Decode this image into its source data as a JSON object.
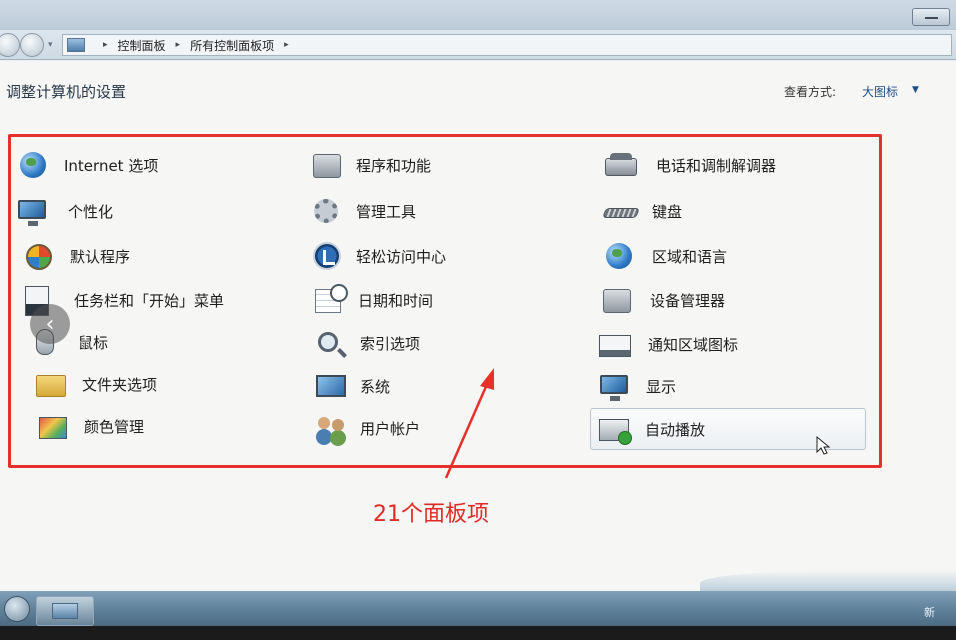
{
  "breadcrumb": {
    "items": [
      "控制面板",
      "所有控制面板项"
    ]
  },
  "header": {
    "title": "调整计算机的设置",
    "view_label": "查看方式:",
    "view_value": "大图标"
  },
  "items": [
    {
      "label": "Internet 选项",
      "icon": "internet-options-icon"
    },
    {
      "label": "程序和功能",
      "icon": "programs-features-icon"
    },
    {
      "label": "电话和调制解调器",
      "icon": "phone-modem-icon"
    },
    {
      "label": "个性化",
      "icon": "personalization-icon"
    },
    {
      "label": "管理工具",
      "icon": "admin-tools-icon"
    },
    {
      "label": "键盘",
      "icon": "keyboard-icon"
    },
    {
      "label": "默认程序",
      "icon": "default-programs-icon"
    },
    {
      "label": "轻松访问中心",
      "icon": "ease-of-access-icon"
    },
    {
      "label": "区域和语言",
      "icon": "region-language-icon"
    },
    {
      "label": "任务栏和「开始」菜单",
      "icon": "taskbar-start-icon"
    },
    {
      "label": "日期和时间",
      "icon": "date-time-icon"
    },
    {
      "label": "设备管理器",
      "icon": "device-manager-icon"
    },
    {
      "label": "鼠标",
      "icon": "mouse-icon"
    },
    {
      "label": "索引选项",
      "icon": "indexing-options-icon"
    },
    {
      "label": "通知区域图标",
      "icon": "notification-area-icon"
    },
    {
      "label": "文件夹选项",
      "icon": "folder-options-icon"
    },
    {
      "label": "系统",
      "icon": "system-icon"
    },
    {
      "label": "显示",
      "icon": "display-icon"
    },
    {
      "label": "颜色管理",
      "icon": "color-management-icon"
    },
    {
      "label": "用户帐户",
      "icon": "user-accounts-icon"
    },
    {
      "label": "自动播放",
      "icon": "autoplay-icon"
    }
  ],
  "annotation": {
    "text": "21个面板项",
    "color": "#e12a23"
  },
  "taskbar": {
    "tray_text": "新"
  }
}
